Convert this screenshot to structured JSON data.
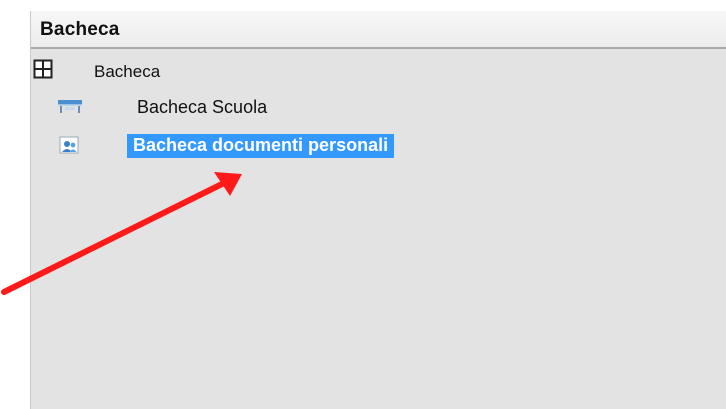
{
  "panel": {
    "title": "Bacheca"
  },
  "tree": {
    "root": {
      "label": "Bacheca",
      "icon": "grid-icon"
    },
    "items": [
      {
        "label": "Bacheca Scuola",
        "icon": "school-board-icon",
        "selected": false
      },
      {
        "label": "Bacheca documenti personali",
        "icon": "personal-documents-icon",
        "selected": true
      }
    ]
  },
  "colors": {
    "selection": "#3399ff",
    "panel_background": "#e3e3e3",
    "arrow": "#ff1a1a"
  }
}
